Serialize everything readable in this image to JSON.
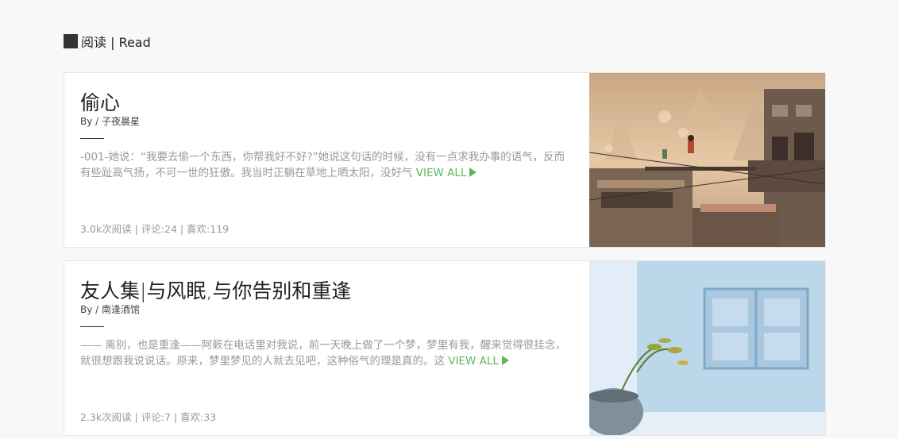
{
  "section": {
    "title": "阅读 | Read"
  },
  "articles": [
    {
      "title": "偷心",
      "author": "By / 子夜晨星",
      "excerpt": "-001-她说：“我要去偷一个东西，你帮我好不好?”她说这句话的时候，没有一点求我办事的语气，反而有些趾高气扬，不可一世的狂傲。我当时正躺在草地上晒太阳，没好气",
      "read_more": "VIEW ALL",
      "stats": "3.0k次阅读 | 评论:24 | 喜欢:119",
      "image_icon": "illustration-city-image"
    },
    {
      "title": "友人集|与风眠,与你告别和重逢",
      "author": "By / 南逢酒馆",
      "excerpt": "—— 离别，也是重逢——阿簌在电话里对我说，前一天晚上做了一个梦，梦里有我，醒来觉得很挂念，就很想跟我说说话。原来，梦里梦见的人就去见吧，这种俗气的理是真的。这",
      "read_more": "VIEW ALL",
      "stats": "2.3k次阅读 | 评论:7 | 喜欢:33",
      "image_icon": "blue-window-plant-image"
    }
  ],
  "colors": {
    "accent": "#5cb85c",
    "muted_text": "#999999",
    "background": "#f8f8f8"
  }
}
